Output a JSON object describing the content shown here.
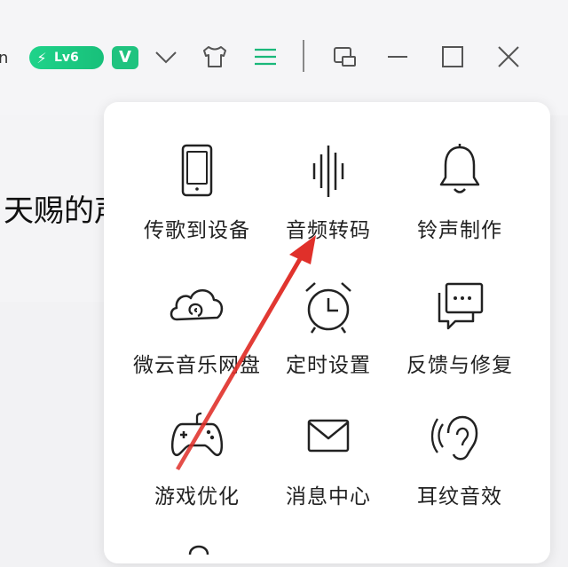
{
  "header": {
    "edge_text": "n",
    "level_badge": "Lv6",
    "vip_badge": "V"
  },
  "background": {
    "song_title_partial": "天赐的声"
  },
  "menu": {
    "items": [
      {
        "label": "传歌到设备",
        "icon": "phone-icon"
      },
      {
        "label": "音频转码",
        "icon": "waveform-icon"
      },
      {
        "label": "铃声制作",
        "icon": "bell-icon"
      },
      {
        "label": "微云音乐网盘",
        "icon": "cloud-icon"
      },
      {
        "label": "定时设置",
        "icon": "alarm-clock-icon"
      },
      {
        "label": "反馈与修复",
        "icon": "feedback-icon"
      },
      {
        "label": "游戏优化",
        "icon": "gamepad-icon"
      },
      {
        "label": "消息中心",
        "icon": "envelope-icon"
      },
      {
        "label": "耳纹音效",
        "icon": "ear-icon"
      }
    ]
  },
  "colors": {
    "accent_green": "#1fc37f",
    "menu_icon_green": "#1ab87a",
    "arrow_red": "#e0302a"
  }
}
